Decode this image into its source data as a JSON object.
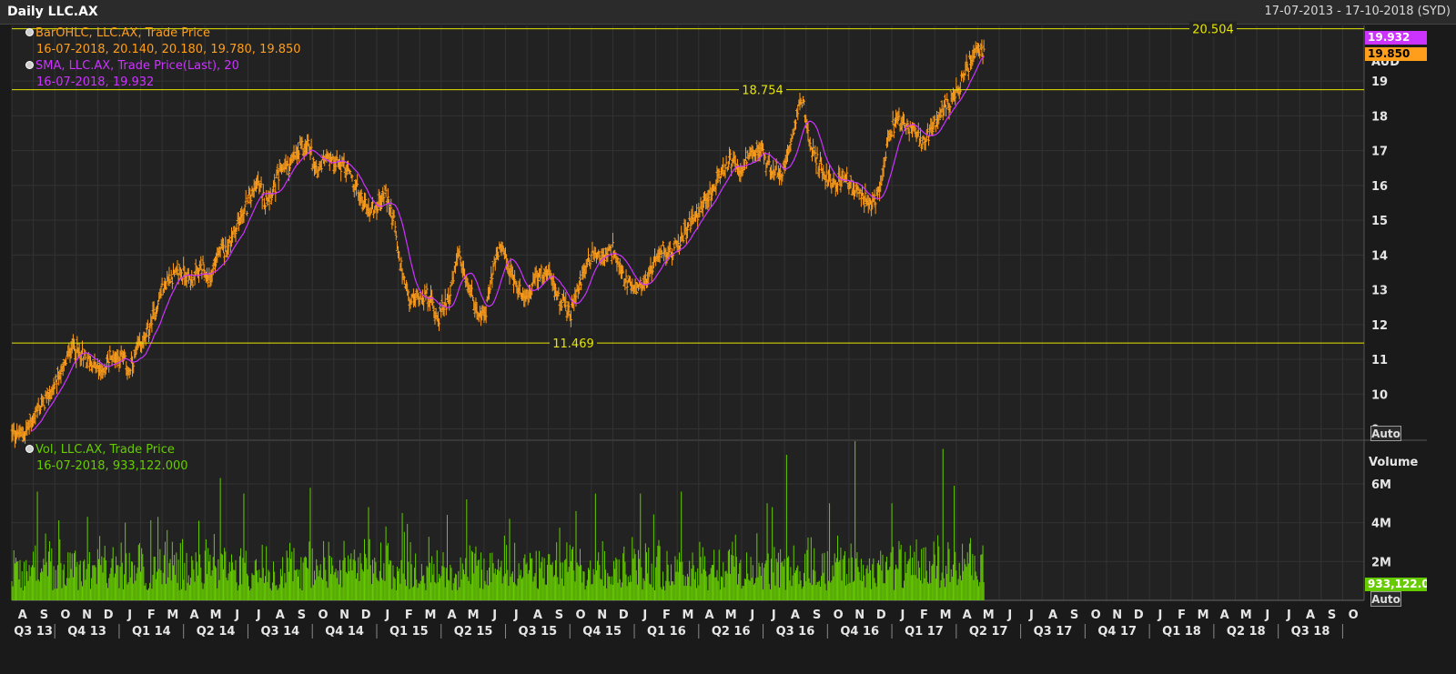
{
  "header": {
    "title": "Daily LLC.AX",
    "range": "17-07-2013 - 17-10-2018 (SYD)"
  },
  "legend": {
    "ohlc": {
      "label": "BarOHLC, LLC.AX, Trade Price",
      "value": "16-07-2018, 20.140, 20.180, 19.780, 19.850"
    },
    "sma": {
      "label": "SMA, LLC.AX, Trade Price(Last),  20",
      "value": "16-07-2018, 19.932"
    },
    "vol": {
      "label": "Vol, LLC.AX, Trade Price",
      "value": "16-07-2018, 933,122.000"
    }
  },
  "colors": {
    "ohlc": "#ff9e1a",
    "sma": "#cc33ff",
    "volume": "#66cc00",
    "hline": "#e6e600",
    "grid": "#333333",
    "axis_text": "#e6e6e6"
  },
  "price_axis": {
    "unit": "AUD",
    "ticks": [
      9,
      10,
      11,
      12,
      13,
      14,
      15,
      16,
      17,
      18,
      19
    ],
    "ylim": [
      8.7,
      20.6
    ],
    "auto_label": "Auto"
  },
  "volume_axis": {
    "title": "Volume",
    "ticks": [
      {
        "v": 2,
        "label": "2M"
      },
      {
        "v": 4,
        "label": "4M"
      },
      {
        "v": 6,
        "label": "6M"
      }
    ],
    "ylim": [
      0,
      8.2
    ],
    "auto_label": "Auto",
    "last_label": "933,122.0"
  },
  "last_tags": {
    "sma": "19.932",
    "close": "19.850"
  },
  "chart_data": {
    "type": "line",
    "title": "Daily LLC.AX",
    "x_range": [
      "17-07-2013",
      "17-10-2018"
    ],
    "x_month_labels": [
      "A",
      "S",
      "O",
      "N",
      "D",
      "J",
      "F",
      "M",
      "A",
      "M",
      "J",
      "J",
      "A",
      "S",
      "O",
      "N",
      "D",
      "J",
      "F",
      "M",
      "A",
      "M",
      "J",
      "J",
      "A",
      "S",
      "O",
      "N",
      "D",
      "J",
      "F",
      "M",
      "A",
      "M",
      "J",
      "J",
      "A",
      "S",
      "O",
      "N",
      "D",
      "J",
      "F",
      "M",
      "A",
      "M",
      "J",
      "J",
      "A",
      "S",
      "O",
      "N",
      "D",
      "J",
      "F",
      "M",
      "A",
      "M",
      "J",
      "J",
      "A",
      "S",
      "O"
    ],
    "x_quarter_labels": [
      "Q3 13",
      "Q4 13",
      "Q1 14",
      "Q2 14",
      "Q3 14",
      "Q4 14",
      "Q1 15",
      "Q2 15",
      "Q3 15",
      "Q4 15",
      "Q1 16",
      "Q2 16",
      "Q3 16",
      "Q4 16",
      "Q1 17",
      "Q2 17",
      "Q3 17",
      "Q4 17",
      "Q1 18",
      "Q2 18",
      "Q3 18"
    ],
    "horizontal_lines": [
      {
        "value": 20.504,
        "label": "20.504"
      },
      {
        "value": 18.754,
        "label": "18.754"
      },
      {
        "value": 11.469,
        "label": "11.469"
      }
    ],
    "series": [
      {
        "name": "BarOHLC, LLC.AX, Trade Price",
        "anchors": [
          [
            0,
            8.9
          ],
          [
            0.5,
            8.8
          ],
          [
            1,
            9.3
          ],
          [
            1.5,
            9.8
          ],
          [
            2,
            10.2
          ],
          [
            2.5,
            10.9
          ],
          [
            2.8,
            11.4
          ],
          [
            3.2,
            11.1
          ],
          [
            3.7,
            10.9
          ],
          [
            4.2,
            10.6
          ],
          [
            4.6,
            11.1
          ],
          [
            5.1,
            11.1
          ],
          [
            5.5,
            10.6
          ],
          [
            5.9,
            11.3
          ],
          [
            6.3,
            11.7
          ],
          [
            6.7,
            12.4
          ],
          [
            7,
            13.0
          ],
          [
            7.4,
            13.4
          ],
          [
            7.9,
            13.5
          ],
          [
            8.4,
            13.3
          ],
          [
            8.8,
            13.6
          ],
          [
            9.2,
            13.3
          ],
          [
            9.6,
            14.0
          ],
          [
            10.1,
            14.3
          ],
          [
            10.6,
            15.0
          ],
          [
            11,
            15.5
          ],
          [
            11.4,
            16.1
          ],
          [
            11.8,
            15.6
          ],
          [
            12.2,
            15.9
          ],
          [
            12.6,
            16.5
          ],
          [
            13,
            16.6
          ],
          [
            13.4,
            17.0
          ],
          [
            13.8,
            17.2
          ],
          [
            14.2,
            16.4
          ],
          [
            14.7,
            16.9
          ],
          [
            15.2,
            16.6
          ],
          [
            15.6,
            16.5
          ],
          [
            16.1,
            15.8
          ],
          [
            16.6,
            15.3
          ],
          [
            17,
            15.4
          ],
          [
            17.4,
            15.8
          ],
          [
            17.8,
            15.0
          ],
          [
            18,
            14.0
          ],
          [
            18.3,
            13.2
          ],
          [
            18.6,
            12.6
          ],
          [
            19.1,
            12.9
          ],
          [
            19.5,
            12.7
          ],
          [
            19.9,
            12.2
          ],
          [
            20.4,
            12.9
          ],
          [
            20.8,
            14.0
          ],
          [
            21.1,
            13.3
          ],
          [
            21.5,
            12.8
          ],
          [
            21.8,
            12.1
          ],
          [
            22.1,
            12.4
          ],
          [
            22.4,
            13.6
          ],
          [
            22.8,
            14.2
          ],
          [
            23.2,
            13.5
          ],
          [
            23.6,
            13.0
          ],
          [
            24,
            12.8
          ],
          [
            24.4,
            13.3
          ],
          [
            24.9,
            13.5
          ],
          [
            25.3,
            13.1
          ],
          [
            25.7,
            12.5
          ],
          [
            26,
            12.3
          ],
          [
            26.4,
            13.0
          ],
          [
            26.8,
            13.8
          ],
          [
            27.2,
            14.1
          ],
          [
            27.6,
            13.9
          ],
          [
            28,
            14.2
          ],
          [
            28.4,
            13.4
          ],
          [
            28.9,
            13.0
          ],
          [
            29.4,
            13.2
          ],
          [
            29.8,
            13.6
          ],
          [
            30.3,
            14.2
          ],
          [
            30.7,
            14.0
          ],
          [
            31.2,
            14.5
          ],
          [
            31.7,
            15.0
          ],
          [
            32.2,
            15.5
          ],
          [
            32.6,
            15.8
          ],
          [
            33.1,
            16.4
          ],
          [
            33.5,
            16.7
          ],
          [
            34,
            16.4
          ],
          [
            34.4,
            16.8
          ],
          [
            34.9,
            17.1
          ],
          [
            35.4,
            16.4
          ],
          [
            35.9,
            16.4
          ],
          [
            36.3,
            17.3
          ],
          [
            36.6,
            18.2
          ],
          [
            36.9,
            18.5
          ],
          [
            37.1,
            17.3
          ],
          [
            37.5,
            16.7
          ],
          [
            38,
            16.2
          ],
          [
            38.4,
            16.1
          ],
          [
            38.9,
            16.2
          ],
          [
            39.5,
            15.7
          ],
          [
            40,
            15.4
          ],
          [
            40.4,
            15.8
          ],
          [
            40.8,
            17.4
          ],
          [
            41.2,
            17.9
          ],
          [
            41.6,
            17.7
          ],
          [
            42,
            17.6
          ],
          [
            42.4,
            17.2
          ],
          [
            42.8,
            17.5
          ],
          [
            43.3,
            18.1
          ],
          [
            43.7,
            18.4
          ],
          [
            44.1,
            18.8
          ],
          [
            44.6,
            19.5
          ],
          [
            45,
            19.9
          ],
          [
            45.3,
            19.85
          ]
        ]
      },
      {
        "name": "SMA, LLC.AX, Trade Price(Last),  20",
        "source": "20-period simple moving average of trade price"
      },
      {
        "name": "Vol, LLC.AX, Trade Price",
        "unit": "M",
        "typical_range": [
          0.5,
          3
        ],
        "last": 0.933,
        "spikes": [
          [
            1.2,
            5.6
          ],
          [
            3.5,
            4.3
          ],
          [
            5.3,
            4.0
          ],
          [
            6.8,
            4.3
          ],
          [
            8.7,
            4.1
          ],
          [
            9.7,
            6.3
          ],
          [
            10.8,
            5.5
          ],
          [
            13.9,
            5.8
          ],
          [
            16.6,
            4.8
          ],
          [
            18.2,
            4.5
          ],
          [
            20.3,
            4.4
          ],
          [
            21.2,
            5.2
          ],
          [
            23.2,
            4.2
          ],
          [
            26.3,
            4.6
          ],
          [
            27.2,
            5.5
          ],
          [
            29.3,
            5.5
          ],
          [
            31.2,
            5.6
          ],
          [
            35.2,
            5.0
          ],
          [
            36.1,
            7.5
          ],
          [
            38.1,
            5.0
          ],
          [
            39.3,
            8.2
          ],
          [
            41.0,
            5.0
          ],
          [
            43.4,
            7.8
          ],
          [
            43.9,
            5.9
          ]
        ]
      }
    ]
  }
}
